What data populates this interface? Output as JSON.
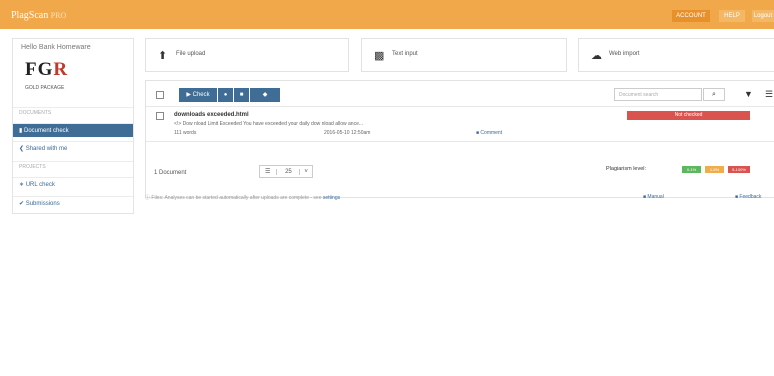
{
  "header": {
    "brand": "PlagScan",
    "brand_suffix": "PRO",
    "btn_account": "ACCOUNT",
    "btn_help": "HELP",
    "btn_logout": "Logout"
  },
  "sidebar": {
    "user": "Hello Bank Homeware",
    "logo_main": "FGR",
    "logo_sub": "GOLD PACKAGE",
    "section_documents": "DOCUMENTS",
    "item_document_check": "Document check",
    "item_shared_with_me": "Shared with me",
    "section_projects": "PROJECTS",
    "item_url_check": "URL check",
    "item_submissions": "Submissions"
  },
  "cards": {
    "upload": "File upload",
    "text": "Text input",
    "web": "Web import"
  },
  "toolbar": {
    "check_label": "Check",
    "search_placeholder": "Document search"
  },
  "documents": [
    {
      "title": "downloads exceeded.html",
      "snippet": "<!> Dow nload Limit Exceeded You have exceeded your daily dow nload allow ance...",
      "words": "111 words",
      "date": "2016-05-10 12:50am",
      "comments": "Comment",
      "result": "Not checked"
    }
  ],
  "list_footer": {
    "count": "1 Document",
    "per_page": "25",
    "plagiarism_label": "Plagiarism level:",
    "level_low": "0-1%",
    "level_mid": "1-5%",
    "level_high": "5-100%"
  },
  "footer": {
    "note": "Files: Analyses can be started automatically after uploads are complete - see",
    "settings_link": "settings",
    "manual_link": "Manual",
    "feedback_link": "Feedback"
  },
  "colors": {
    "header": "#f0a84a",
    "nav_active": "#3f6d95",
    "danger": "#d9534f",
    "level_low": "#5cb85c",
    "level_mid": "#f0ad4e",
    "level_high": "#d9534f"
  }
}
